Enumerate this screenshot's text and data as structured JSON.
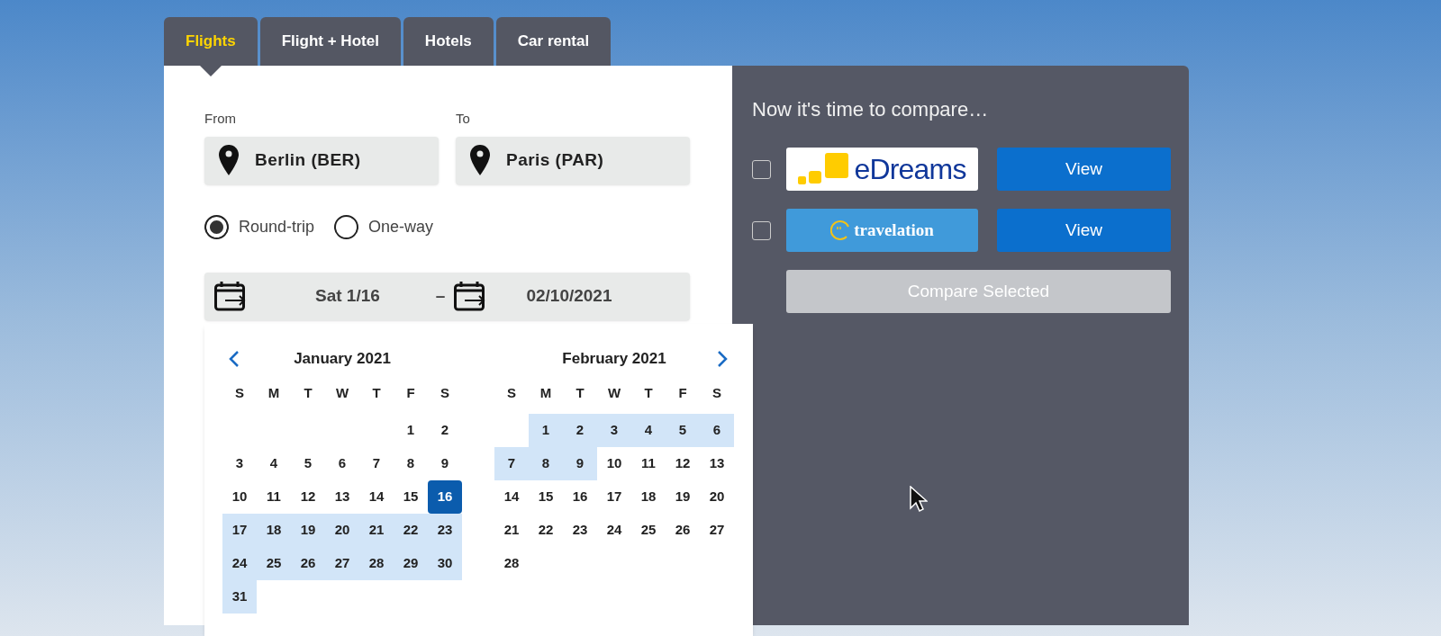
{
  "tabs": [
    {
      "label": "Flights",
      "selected": true
    },
    {
      "label": "Flight + Hotel",
      "selected": false
    },
    {
      "label": "Hotels",
      "selected": false
    },
    {
      "label": "Car rental",
      "selected": false
    }
  ],
  "from": {
    "label": "From",
    "value": "Berlin (BER)"
  },
  "to": {
    "label": "To",
    "value": "Paris (PAR)"
  },
  "trip_types": [
    {
      "label": "Round-trip",
      "selected": true
    },
    {
      "label": "One-way",
      "selected": false
    }
  ],
  "dates": {
    "depart": "Sat 1/16",
    "separator": "–",
    "return": "02/10/2021"
  },
  "calendar": {
    "months": [
      {
        "title": "January 2021",
        "kind": "prev",
        "weekdays": [
          "S",
          "M",
          "T",
          "W",
          "T",
          "F",
          "S"
        ],
        "weeks": [
          [
            {
              "kind": "blank"
            },
            {
              "kind": "blank"
            },
            {
              "kind": "blank"
            },
            {
              "kind": "blank"
            },
            {
              "kind": "blank"
            },
            {
              "kind": "day",
              "label": "1",
              "in_range": false,
              "selected": false
            },
            {
              "kind": "day",
              "label": "2",
              "in_range": false,
              "selected": false
            }
          ],
          [
            {
              "kind": "day",
              "label": "3",
              "in_range": false,
              "selected": false
            },
            {
              "kind": "day",
              "label": "4",
              "in_range": false,
              "selected": false
            },
            {
              "kind": "day",
              "label": "5",
              "in_range": false,
              "selected": false
            },
            {
              "kind": "day",
              "label": "6",
              "in_range": false,
              "selected": false
            },
            {
              "kind": "day",
              "label": "7",
              "in_range": false,
              "selected": false
            },
            {
              "kind": "day",
              "label": "8",
              "in_range": false,
              "selected": false
            },
            {
              "kind": "day",
              "label": "9",
              "in_range": false,
              "selected": false
            }
          ],
          [
            {
              "kind": "day",
              "label": "10",
              "in_range": false,
              "selected": false
            },
            {
              "kind": "day",
              "label": "11",
              "in_range": false,
              "selected": false
            },
            {
              "kind": "day",
              "label": "12",
              "in_range": false,
              "selected": false
            },
            {
              "kind": "day",
              "label": "13",
              "in_range": false,
              "selected": false
            },
            {
              "kind": "day",
              "label": "14",
              "in_range": false,
              "selected": false
            },
            {
              "kind": "day",
              "label": "15",
              "in_range": false,
              "selected": false
            },
            {
              "kind": "day",
              "label": "16",
              "in_range": false,
              "selected": true
            }
          ],
          [
            {
              "kind": "day",
              "label": "17",
              "in_range": true,
              "selected": false
            },
            {
              "kind": "day",
              "label": "18",
              "in_range": true,
              "selected": false
            },
            {
              "kind": "day",
              "label": "19",
              "in_range": true,
              "selected": false
            },
            {
              "kind": "day",
              "label": "20",
              "in_range": true,
              "selected": false
            },
            {
              "kind": "day",
              "label": "21",
              "in_range": true,
              "selected": false
            },
            {
              "kind": "day",
              "label": "22",
              "in_range": true,
              "selected": false
            },
            {
              "kind": "day",
              "label": "23",
              "in_range": true,
              "selected": false
            }
          ],
          [
            {
              "kind": "day",
              "label": "24",
              "in_range": true,
              "selected": false
            },
            {
              "kind": "day",
              "label": "25",
              "in_range": true,
              "selected": false
            },
            {
              "kind": "day",
              "label": "26",
              "in_range": true,
              "selected": false
            },
            {
              "kind": "day",
              "label": "27",
              "in_range": true,
              "selected": false
            },
            {
              "kind": "day",
              "label": "28",
              "in_range": true,
              "selected": false
            },
            {
              "kind": "day",
              "label": "29",
              "in_range": true,
              "selected": false
            },
            {
              "kind": "day",
              "label": "30",
              "in_range": true,
              "selected": false
            }
          ],
          [
            {
              "kind": "day",
              "label": "31",
              "in_range": true,
              "selected": false
            }
          ]
        ]
      },
      {
        "title": "February 2021",
        "kind": "next",
        "weekdays": [
          "S",
          "M",
          "T",
          "W",
          "T",
          "F",
          "S"
        ],
        "weeks": [
          [
            {
              "kind": "blank"
            },
            {
              "kind": "day",
              "label": "1",
              "in_range": true,
              "selected": false
            },
            {
              "kind": "day",
              "label": "2",
              "in_range": true,
              "selected": false
            },
            {
              "kind": "day",
              "label": "3",
              "in_range": true,
              "selected": false
            },
            {
              "kind": "day",
              "label": "4",
              "in_range": true,
              "selected": false
            },
            {
              "kind": "day",
              "label": "5",
              "in_range": true,
              "selected": false
            },
            {
              "kind": "day",
              "label": "6",
              "in_range": true,
              "selected": false
            }
          ],
          [
            {
              "kind": "day",
              "label": "7",
              "in_range": true,
              "selected": false
            },
            {
              "kind": "day",
              "label": "8",
              "in_range": true,
              "selected": false
            },
            {
              "kind": "day",
              "label": "9",
              "in_range": true,
              "selected": false
            },
            {
              "kind": "day",
              "label": "10",
              "in_range": false,
              "selected": false
            },
            {
              "kind": "day",
              "label": "11",
              "in_range": false,
              "selected": false
            },
            {
              "kind": "day",
              "label": "12",
              "in_range": false,
              "selected": false
            },
            {
              "kind": "day",
              "label": "13",
              "in_range": false,
              "selected": false
            }
          ],
          [
            {
              "kind": "day",
              "label": "14",
              "in_range": false,
              "selected": false
            },
            {
              "kind": "day",
              "label": "15",
              "in_range": false,
              "selected": false
            },
            {
              "kind": "day",
              "label": "16",
              "in_range": false,
              "selected": false
            },
            {
              "kind": "day",
              "label": "17",
              "in_range": false,
              "selected": false
            },
            {
              "kind": "day",
              "label": "18",
              "in_range": false,
              "selected": false
            },
            {
              "kind": "day",
              "label": "19",
              "in_range": false,
              "selected": false
            },
            {
              "kind": "day",
              "label": "20",
              "in_range": false,
              "selected": false
            }
          ],
          [
            {
              "kind": "day",
              "label": "21",
              "in_range": false,
              "selected": false
            },
            {
              "kind": "day",
              "label": "22",
              "in_range": false,
              "selected": false
            },
            {
              "kind": "day",
              "label": "23",
              "in_range": false,
              "selected": false
            },
            {
              "kind": "day",
              "label": "24",
              "in_range": false,
              "selected": false
            },
            {
              "kind": "day",
              "label": "25",
              "in_range": false,
              "selected": false
            },
            {
              "kind": "day",
              "label": "26",
              "in_range": false,
              "selected": false
            },
            {
              "kind": "day",
              "label": "27",
              "in_range": false,
              "selected": false
            }
          ],
          [
            {
              "kind": "day",
              "label": "28",
              "in_range": false,
              "selected": false
            }
          ]
        ]
      }
    ]
  },
  "compare": {
    "title": "Now it's time to compare…",
    "providers": [
      {
        "kind": "edreams",
        "name": "eDreams",
        "checked": false,
        "button": "View"
      },
      {
        "kind": "travelation",
        "name": "travelation",
        "checked": false,
        "button": "View"
      }
    ],
    "compare_button": {
      "label": "Compare Selected",
      "disabled": true
    }
  }
}
